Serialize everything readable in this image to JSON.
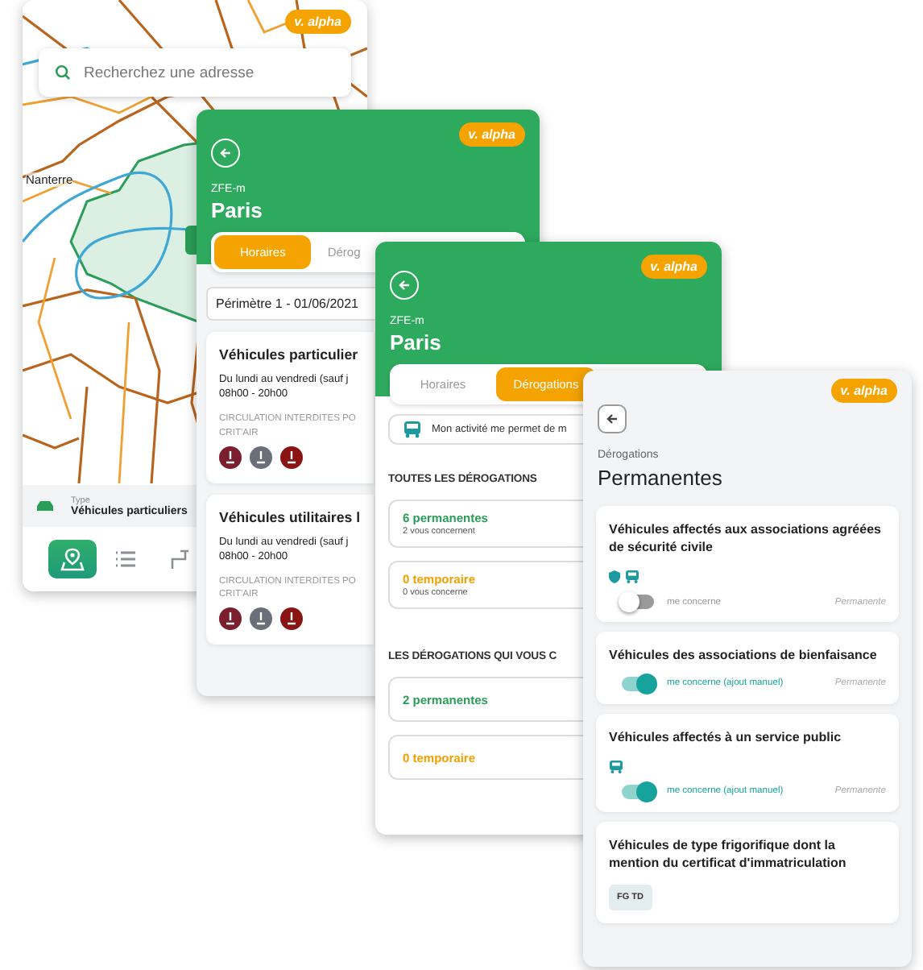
{
  "map_screen": {
    "badge": "v. alpha",
    "search": {
      "placeholder": "Recherchez une adresse"
    },
    "place_label": "Nanterre",
    "vehicle": {
      "label": "Type",
      "value": "Véhicules particuliers"
    },
    "nav": [
      {
        "kind": "map",
        "selected": true
      },
      {
        "kind": "list",
        "selected": false
      },
      {
        "kind": "route",
        "selected": false
      }
    ]
  },
  "schedule_screen": {
    "badge": "v. alpha",
    "zone": "ZFE-m",
    "city": "Paris",
    "tabs": [
      {
        "label": "Horaires",
        "selected": true
      },
      {
        "label": "Dérog",
        "selected": false
      }
    ],
    "perimeter": "Périmètre 1 - 01/06/2021",
    "cards": [
      {
        "title": "Véhicules particulier",
        "days": "Du lundi au vendredi (sauf j",
        "hours": "08h00 - 20h00",
        "restriction": [
          "CIRCULATION INTERDITES PO",
          "CRIT'AIR"
        ],
        "badges": [
          {
            "color": "#7b1e2e"
          },
          {
            "color": "#6b7078"
          },
          {
            "color": "#8a1414"
          }
        ]
      },
      {
        "title": "Véhicules utilitaires l",
        "days": "Du lundi au vendredi (sauf j",
        "hours": "08h00 - 20h00",
        "restriction": [
          "CIRCULATION INTERDITES PO",
          "CRIT'AIR"
        ],
        "badges": [
          {
            "color": "#7b1e2e"
          },
          {
            "color": "#6b7078"
          },
          {
            "color": "#8a1414"
          }
        ]
      }
    ]
  },
  "exemptions_screen": {
    "badge": "v. alpha",
    "zone": "ZFE-m",
    "city": "Paris",
    "tabs": [
      {
        "label": "Horaires",
        "selected": false
      },
      {
        "label": "Dérogations",
        "selected": true
      }
    ],
    "activity": "Mon activité me permet de m",
    "sections": [
      {
        "heading": "TOUTES LES DÉROGATIONS",
        "items": [
          {
            "kind": "permanent",
            "title": "6 permanentes",
            "subtitle": "2 vous concernent"
          },
          {
            "kind": "temporary",
            "title": "0 temporaire",
            "subtitle": "0 vous concerne"
          }
        ]
      },
      {
        "heading": "LES DÉROGATIONS QUI VOUS C",
        "items": [
          {
            "kind": "permanent",
            "title": "2 permanentes"
          },
          {
            "kind": "temporary",
            "title": "0 temporaire"
          }
        ]
      }
    ]
  },
  "permanent_screen": {
    "badge": "v. alpha",
    "section": "Dérogations",
    "title": "Permanentes",
    "cards": [
      {
        "title": "Véhicules affectés aux associations agréées de sécurité civile",
        "tags": [
          {
            "kind": "shield"
          },
          {
            "kind": "bus"
          }
        ],
        "toggle": {
          "on": false,
          "label": "me concerne"
        },
        "status": "Permanente"
      },
      {
        "title": "Véhicules des associations de bienfaisance",
        "toggle": {
          "on": true,
          "label": "me concerne (ajout manuel)"
        },
        "status": "Permanente"
      },
      {
        "title": "Véhicules affectés à un service public",
        "tags": [
          {
            "kind": "bus"
          }
        ],
        "toggle": {
          "on": true,
          "label": "me concerne (ajout manuel)"
        },
        "status": "Permanente"
      },
      {
        "title": "Véhicules de type frigorifique dont la mention du certificat d'immatriculation",
        "chips": [
          "FG TD"
        ]
      }
    ]
  }
}
